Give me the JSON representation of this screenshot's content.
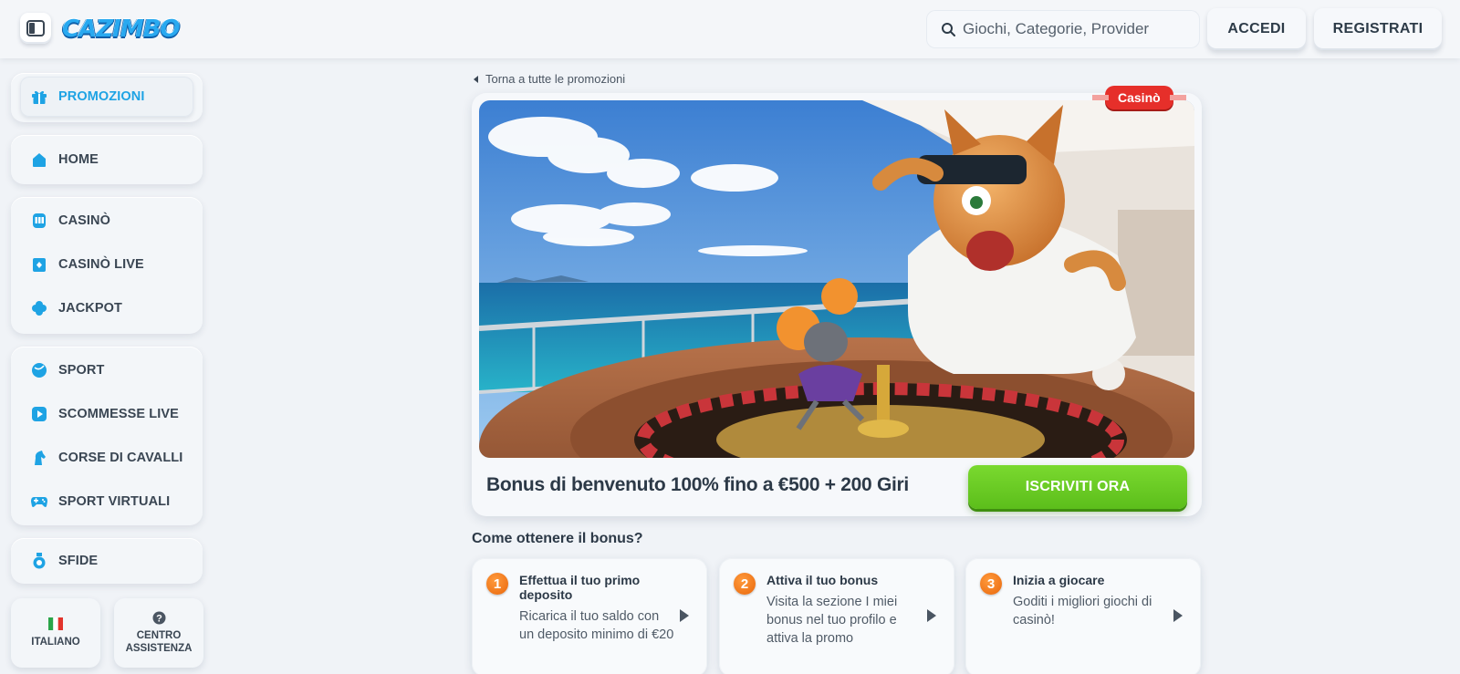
{
  "header": {
    "logo_text": "CAZIMBO",
    "search_placeholder": "Giochi, Categorie, Provider",
    "login_label": "ACCEDI",
    "register_label": "REGISTRATI"
  },
  "sidebar": {
    "promo": {
      "label": "PROMOZIONI",
      "icon": "gift-icon"
    },
    "home": {
      "label": "HOME",
      "icon": "home-icon"
    },
    "casino": [
      {
        "label": "CASINÒ",
        "icon": "slot-machine-icon"
      },
      {
        "label": "CASINÒ LIVE",
        "icon": "live-cards-icon"
      },
      {
        "label": "JACKPOT",
        "icon": "clover-icon"
      }
    ],
    "sport": [
      {
        "label": "SPORT",
        "icon": "ball-icon"
      },
      {
        "label": "SCOMMESSE LIVE",
        "icon": "play-icon"
      },
      {
        "label": "CORSE DI CAVALLI",
        "icon": "horse-icon"
      },
      {
        "label": "SPORT VIRTUALI",
        "icon": "gamepad-icon"
      }
    ],
    "challenges": {
      "label": "SFIDE",
      "icon": "medal-icon"
    },
    "language_label": "ITALIANO",
    "help_label_1": "CENTRO",
    "help_label_2": "ASSISTENZA"
  },
  "main": {
    "back_link": "Torna a tutte le promozioni",
    "category_badge": "Casinò",
    "promo_title": "Bonus di benvenuto 100% fino a €500 + 200 Giri",
    "cta_label": "ISCRIVITI ORA",
    "how_title": "Come ottenere il bonus?",
    "steps": [
      {
        "num": "1",
        "title": "Effettua il tuo primo deposito",
        "text": "Ricarica il tuo saldo con un deposito minimo di €20"
      },
      {
        "num": "2",
        "title": "Attiva il tuo bonus",
        "text": "Visita la sezione I miei bonus nel tuo profilo e attiva la promo"
      },
      {
        "num": "3",
        "title": "Inizia a giocare",
        "text": "Goditi i migliori giochi di casinò!"
      }
    ]
  },
  "colors": {
    "accent_blue": "#1ea3e4",
    "cta_green": "#5cbe1b",
    "badge_red": "#e62f2a",
    "step_orange": "#e9670c"
  }
}
